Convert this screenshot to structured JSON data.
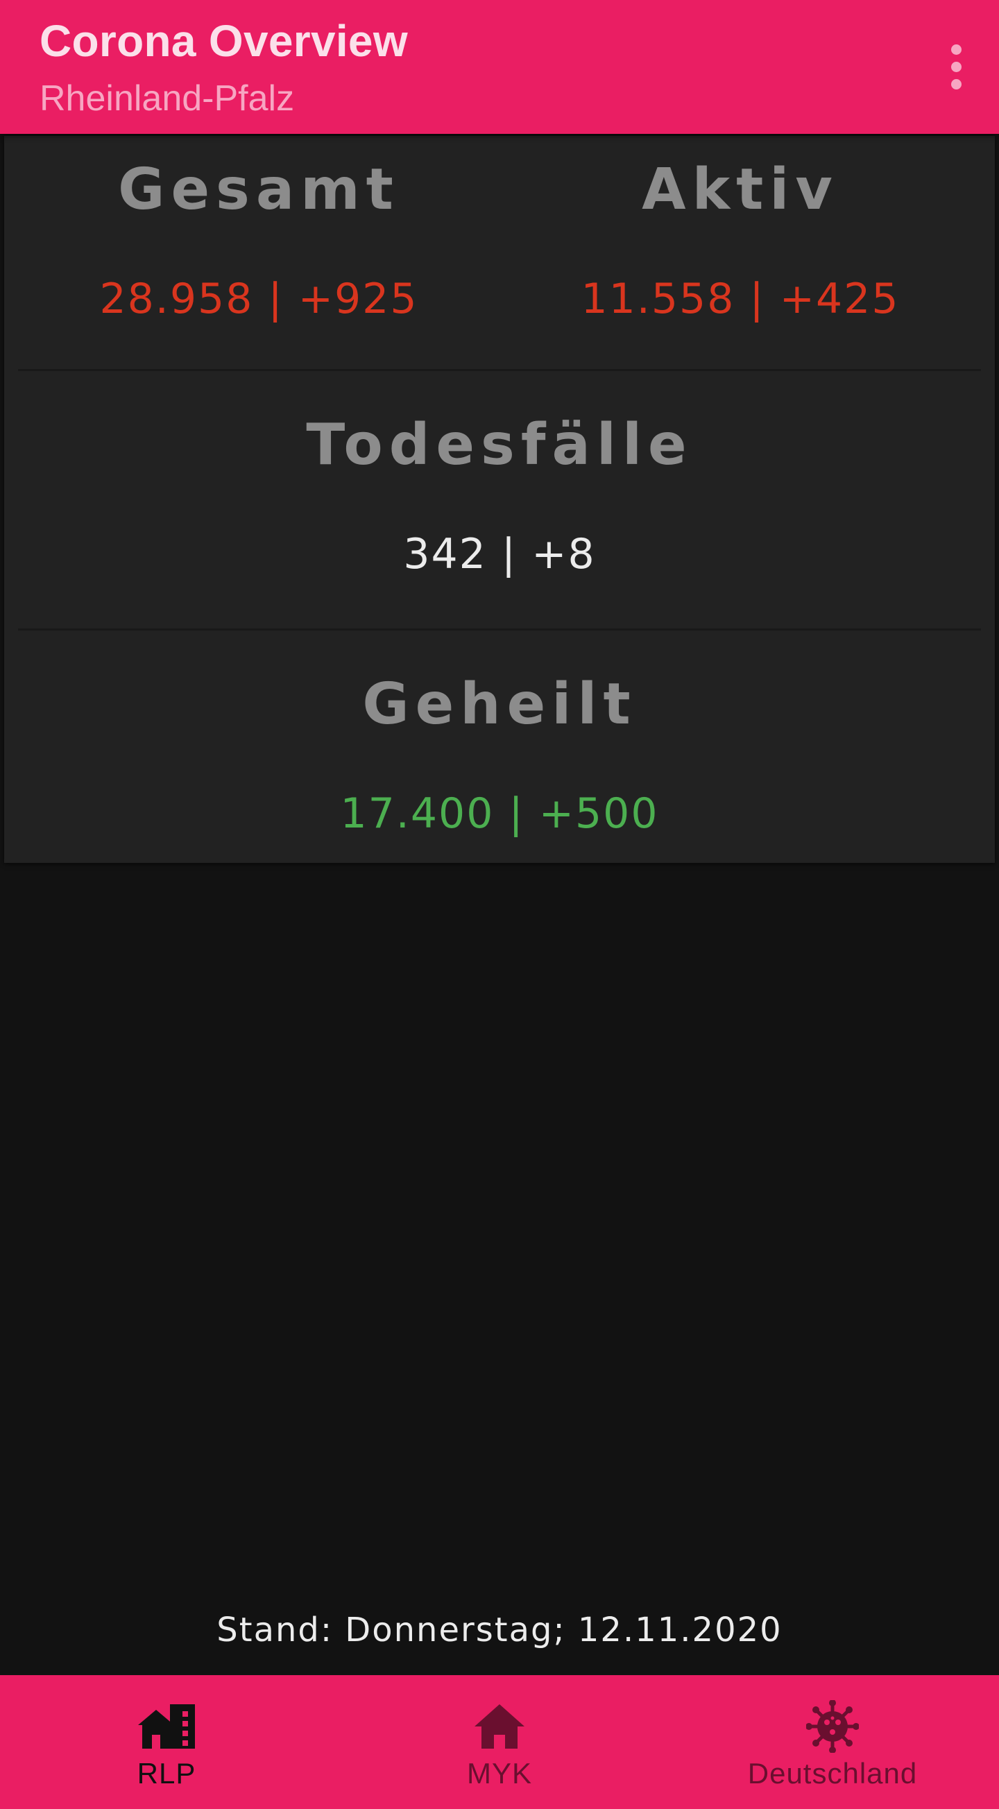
{
  "appbar": {
    "title": "Corona Overview",
    "subtitle": "Rheinland-Pfalz",
    "overflow_icon": "more-vert-icon"
  },
  "stats": {
    "gesamt": {
      "label": "Gesamt",
      "value": "28.958 | +925"
    },
    "aktiv": {
      "label": "Aktiv",
      "value": "11.558 | +425"
    },
    "todesfaelle": {
      "label": "Todesfälle",
      "value": "342 | +8"
    },
    "geheilt": {
      "label": "Geheilt",
      "value": "17.400 | +500"
    }
  },
  "footer": {
    "stand": "Stand: Donnerstag; 12.11.2020"
  },
  "bottom_nav": {
    "items": [
      {
        "label": "RLP",
        "icon": "city-icon",
        "selected": true
      },
      {
        "label": "MYK",
        "icon": "home-icon",
        "selected": false
      },
      {
        "label": "Deutschland",
        "icon": "virus-icon",
        "selected": false
      }
    ]
  },
  "colors": {
    "primary": "#ea1e63",
    "background": "#121212",
    "card": "#222222",
    "negative": "#d9351e",
    "positive": "#4caf50",
    "nav_selected": "#111111",
    "nav_unselected": "#6a0f2f"
  }
}
